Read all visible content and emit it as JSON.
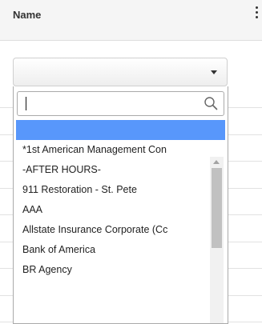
{
  "column": {
    "title": "Name",
    "menu_icon": "kebab-menu-icon"
  },
  "filter": {
    "selected_value": "",
    "arrow_icon": "chevron-down-icon"
  },
  "dropdown": {
    "search": {
      "value": "",
      "placeholder": "",
      "icon": "search-icon"
    },
    "highlighted_option": "",
    "options": [
      "*1st American Management Con",
      "-AFTER HOURS-",
      "911 Restoration - St. Pete",
      "AAA",
      "Allstate Insurance Corporate (Cc",
      "Bank of America",
      "BR Agency"
    ]
  },
  "colors": {
    "highlight": "#5897fb",
    "header_bg": "#f5f5f5",
    "border": "#aaaaaa"
  }
}
